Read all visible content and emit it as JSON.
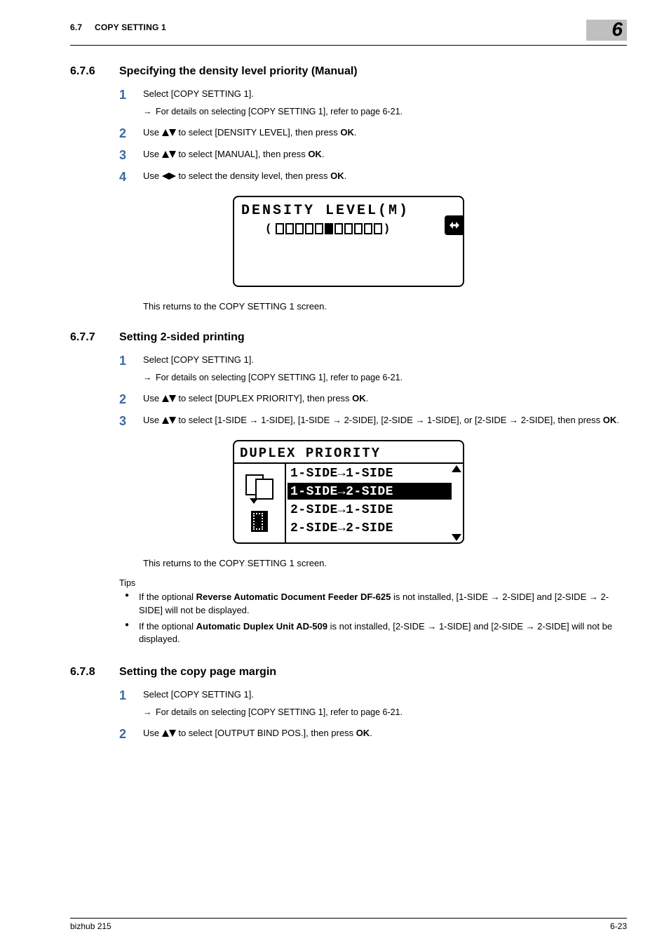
{
  "header": {
    "left_num": "6.7",
    "left_text": "COPY SETTING 1",
    "chapter": "6"
  },
  "s676": {
    "num": "6.7.6",
    "title": "Specifying the density level priority (Manual)",
    "step1": "Select [COPY SETTING 1].",
    "step1_sub": "For details on selecting [COPY SETTING 1], refer to page 6-21.",
    "step2_a": "Use ",
    "step2_b": " to select [DENSITY LEVEL], then press ",
    "step2_ok": "OK",
    "step2_c": ".",
    "step3_a": "Use ",
    "step3_b": " to select [MANUAL], then press ",
    "step3_ok": "OK",
    "step3_c": ".",
    "step4_a": "Use ",
    "step4_b": " to select the density level, then press ",
    "step4_ok": "OK",
    "step4_c": ".",
    "caption": "This returns to the COPY SETTING 1 screen."
  },
  "lcd1": {
    "title": "DENSITY LEVEL(M)",
    "left_glyph": "(",
    "right_glyph": ")",
    "segments": [
      0,
      0,
      0,
      0,
      0,
      1,
      0,
      0,
      0,
      0,
      0
    ]
  },
  "s677": {
    "num": "6.7.7",
    "title": "Setting 2-sided printing",
    "step1": "Select [COPY SETTING 1].",
    "step1_sub": "For details on selecting [COPY SETTING 1], refer to page 6-21.",
    "step2_a": "Use ",
    "step2_b": " to select [DUPLEX PRIORITY], then press ",
    "step2_ok": "OK",
    "step2_c": ".",
    "step3_a": "Use ",
    "step3_b": " to select [1-SIDE → 1-SIDE], [1-SIDE → 2-SIDE], [2-SIDE → 1-SIDE], or [2-SIDE → 2-SIDE], then press ",
    "step3_ok": "OK",
    "step3_c": ".",
    "caption": "This returns to the COPY SETTING 1 screen."
  },
  "lcd2": {
    "title": "DUPLEX PRIORITY",
    "row1": "1-SIDE→1-SIDE",
    "row2": "1-SIDE→2-SIDE",
    "row3": "2-SIDE→1-SIDE",
    "row4": "2-SIDE→2-SIDE"
  },
  "tips": {
    "label": "Tips",
    "t1_a": "If the optional ",
    "t1_b": "Reverse Automatic Document Feeder DF-625",
    "t1_c": " is not installed, [1-SIDE → 2-SIDE] and [2-SIDE → 2-SIDE] will not be displayed.",
    "t2_a": "If the optional ",
    "t2_b": "Automatic Duplex Unit AD-509",
    "t2_c": " is not installed, [2-SIDE → 1-SIDE] and [2-SIDE → 2-SIDE] will not be displayed."
  },
  "s678": {
    "num": "6.7.8",
    "title": "Setting the copy page margin",
    "step1": "Select [COPY SETTING 1].",
    "step1_sub": "For details on selecting [COPY SETTING 1], refer to page 6-21.",
    "step2_a": "Use ",
    "step2_b": " to select [OUTPUT BIND POS.], then press ",
    "step2_ok": "OK",
    "step2_c": "."
  },
  "footer": {
    "left": "bizhub 215",
    "right": "6-23"
  }
}
